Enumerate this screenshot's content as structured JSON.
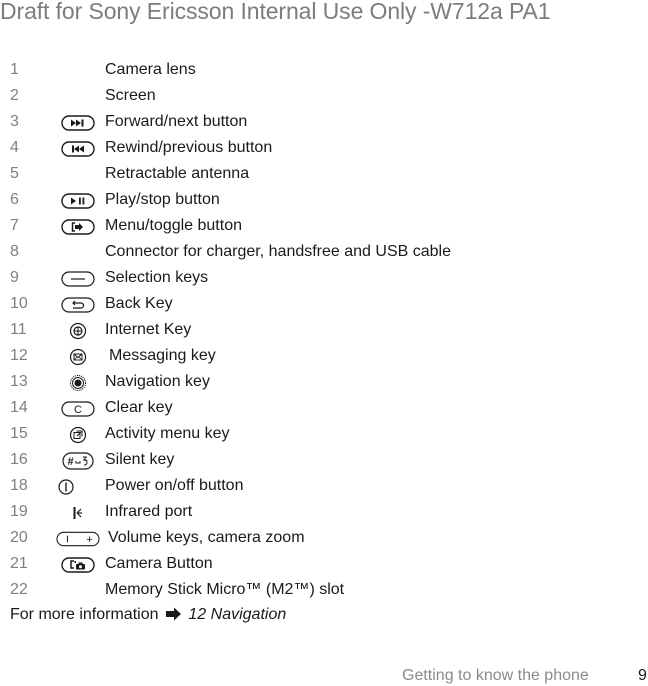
{
  "header": {
    "draft_notice": "Draft for Sony Ericsson Internal Use Only -W712a PA1"
  },
  "items": [
    {
      "number": "1",
      "icon": "none",
      "label": "Camera lens"
    },
    {
      "number": "2",
      "icon": "none",
      "label": "Screen"
    },
    {
      "number": "3",
      "icon": "forward-next-icon",
      "label": "Forward/next button"
    },
    {
      "number": "4",
      "icon": "rewind-previous-icon",
      "label": "Rewind/previous button"
    },
    {
      "number": "5",
      "icon": "none",
      "label": "Retractable antenna"
    },
    {
      "number": "6",
      "icon": "play-pause-icon",
      "label": "Play/stop button"
    },
    {
      "number": "7",
      "icon": "menu-toggle-icon",
      "label": "Menu/toggle button"
    },
    {
      "number": "8",
      "icon": "none",
      "label": "Connector for charger, handsfree and USB cable"
    },
    {
      "number": "9",
      "icon": "selection-key-icon",
      "label": "Selection keys"
    },
    {
      "number": "10",
      "icon": "back-key-icon",
      "label": "Back Key"
    },
    {
      "number": "11",
      "icon": "internet-key-icon",
      "label": "Internet Key"
    },
    {
      "number": "12",
      "icon": "messaging-key-icon",
      "label": "Messaging key"
    },
    {
      "number": "13",
      "icon": "navigation-key-icon",
      "label": "Navigation key"
    },
    {
      "number": "14",
      "icon": "clear-key-icon",
      "label": "Clear key",
      "icon_text": "C"
    },
    {
      "number": "15",
      "icon": "activity-menu-key-icon",
      "label": "Activity menu key"
    },
    {
      "number": "16",
      "icon": "silent-key-icon",
      "label": "Silent key",
      "icon_text": "#"
    },
    {
      "number": "18",
      "icon": "power-icon",
      "label": "Power on/off button"
    },
    {
      "number": "19",
      "icon": "infrared-port-icon",
      "label": "Infrared port"
    },
    {
      "number": "20",
      "icon": "volume-keys-icon",
      "label": "Volume keys, camera zoom",
      "icon_text": "+"
    },
    {
      "number": "21",
      "icon": "camera-button-icon",
      "label": "Camera Button"
    },
    {
      "number": "22",
      "icon": "none",
      "label": "Memory Stick Micro™ (M2™) slot"
    }
  ],
  "more_info": {
    "prefix": "For more information",
    "arrow_icon": "right-arrow-icon",
    "reference": "12 Navigation"
  },
  "footer": {
    "section": "Getting to know the phone",
    "page_number": "9"
  }
}
